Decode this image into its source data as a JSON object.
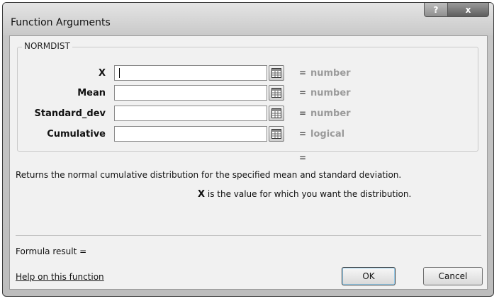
{
  "window": {
    "title": "Function Arguments",
    "help_glyph": "?",
    "close_glyph": "x"
  },
  "function_name": "NORMDIST",
  "arguments": [
    {
      "label": "X",
      "value": "",
      "result": "number"
    },
    {
      "label": "Mean",
      "value": "",
      "result": "number"
    },
    {
      "label": "Standard_dev",
      "value": "",
      "result": "number"
    },
    {
      "label": "Cumulative",
      "value": "",
      "result": "logical"
    }
  ],
  "equals_sign": "=",
  "description": "Returns the normal cumulative distribution for the specified mean and standard deviation.",
  "current_arg": {
    "name": "X",
    "help": "is the value for which you want the distribution."
  },
  "formula_result_label": "Formula result =",
  "help_link": "Help on this function",
  "buttons": {
    "ok": "OK",
    "cancel": "Cancel"
  },
  "icons": {
    "collapse": "range-select-icon"
  }
}
